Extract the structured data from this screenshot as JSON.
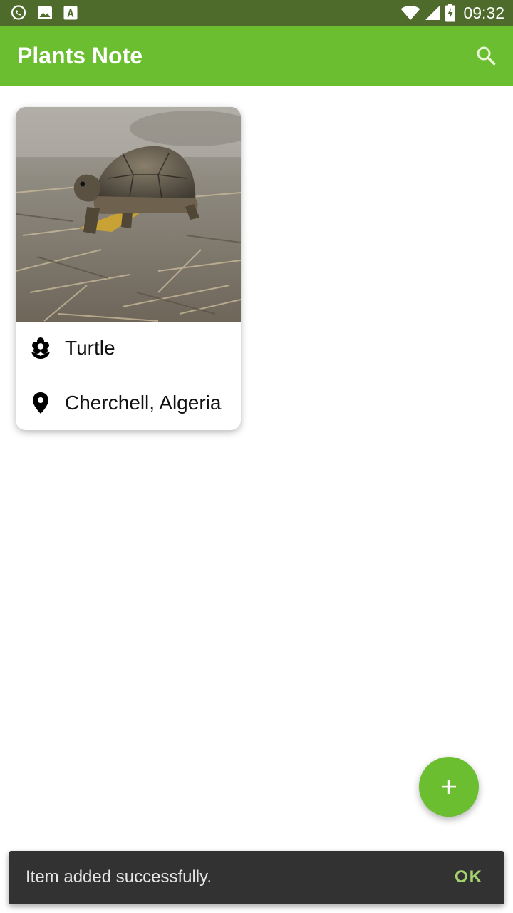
{
  "status_bar": {
    "time": "09:32",
    "notification_icons": [
      "whatsapp-icon",
      "image-icon",
      "font-download-icon"
    ],
    "system_icons": [
      "wifi-icon",
      "cell-signal-icon",
      "battery-charging-icon"
    ]
  },
  "app_bar": {
    "title": "Plants Note",
    "search_icon": "search-icon",
    "background_color": "#6abe2f"
  },
  "cards": [
    {
      "image_description_icon": "turtle-photo",
      "name": "Turtle",
      "name_icon": "local-florist-icon",
      "location": "Cherchell, Algeria",
      "location_icon": "location-pin-icon"
    }
  ],
  "fab": {
    "icon": "add-icon"
  },
  "snackbar": {
    "message": "Item added successfully.",
    "action": "OK",
    "action_color": "#a5d46f"
  }
}
